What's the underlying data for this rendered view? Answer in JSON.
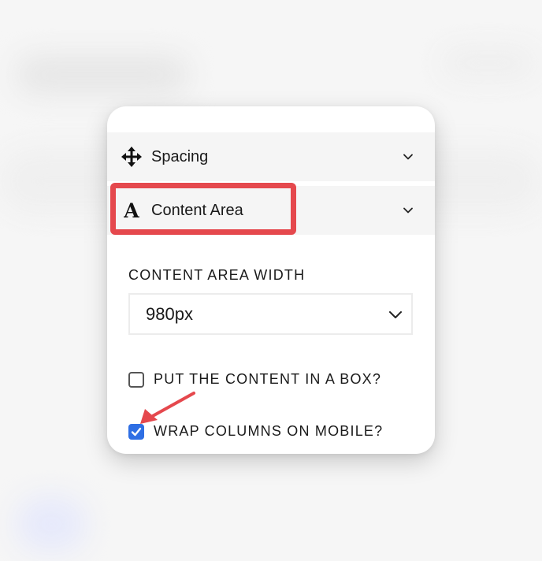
{
  "sections": {
    "spacing": {
      "label": "Spacing",
      "icon": "move-arrows-icon"
    },
    "content_area": {
      "label": "Content Area",
      "icon": "font-letter-a-icon"
    }
  },
  "content_area_width": {
    "label": "CONTENT AREA WIDTH",
    "selected_value": "980px"
  },
  "options": {
    "box": {
      "label": "PUT THE CONTENT IN A BOX?",
      "checked": false
    },
    "wrap": {
      "label": "WRAP COLUMNS ON MOBILE?",
      "checked": true
    }
  },
  "colors": {
    "highlight": "#e5484d",
    "checkbox_accent": "#2f6fe4",
    "row_background": "#f5f5f5"
  }
}
